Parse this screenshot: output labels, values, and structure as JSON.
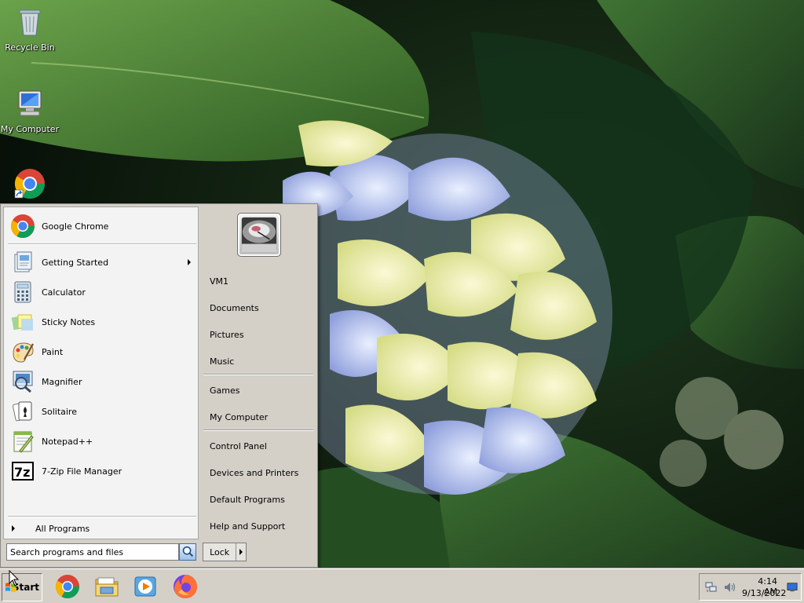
{
  "desktop": {
    "icons": [
      {
        "label": "Recycle Bin",
        "icon": "recycle-bin-icon"
      },
      {
        "label": "My Computer",
        "icon": "computer-icon"
      },
      {
        "label": "",
        "icon": "chrome-shortcut-icon"
      }
    ]
  },
  "start_menu": {
    "pinned": [
      {
        "label": "Google Chrome",
        "icon": "chrome-icon"
      }
    ],
    "recent": [
      {
        "label": "Getting Started",
        "icon": "getting-started-icon",
        "has_submenu": true
      },
      {
        "label": "Calculator",
        "icon": "calculator-icon"
      },
      {
        "label": "Sticky Notes",
        "icon": "sticky-notes-icon"
      },
      {
        "label": "Paint",
        "icon": "paint-icon"
      },
      {
        "label": "Magnifier",
        "icon": "magnifier-icon"
      },
      {
        "label": "Solitaire",
        "icon": "solitaire-icon"
      },
      {
        "label": "Notepad++",
        "icon": "notepad-plus-plus-icon"
      },
      {
        "label": "7-Zip File Manager",
        "icon": "seven-zip-icon"
      }
    ],
    "all_programs_label": "All Programs",
    "places": [
      {
        "label": "VM1"
      },
      {
        "label": "Documents"
      },
      {
        "label": "Pictures"
      },
      {
        "label": "Music"
      },
      {
        "label": "Games"
      },
      {
        "label": "My Computer"
      },
      {
        "label": "Control Panel"
      },
      {
        "label": "Devices and Printers"
      },
      {
        "label": "Default Programs"
      },
      {
        "label": "Help and Support"
      }
    ],
    "search": {
      "placeholder": "Search programs and files",
      "value": ""
    },
    "lock_label": "Lock"
  },
  "taskbar": {
    "start_label": "Start",
    "pinned": [
      {
        "icon": "chrome-icon"
      },
      {
        "icon": "file-explorer-icon"
      },
      {
        "icon": "media-player-icon"
      },
      {
        "icon": "firefox-icon"
      }
    ],
    "clock": {
      "time": "4:14 AM",
      "date": "9/13/2022"
    }
  },
  "colors": {
    "menu_bg": "#d4d0c8",
    "left_pane_bg": "#f3f3f3",
    "taskbar_bg": "#d4d0c8"
  }
}
